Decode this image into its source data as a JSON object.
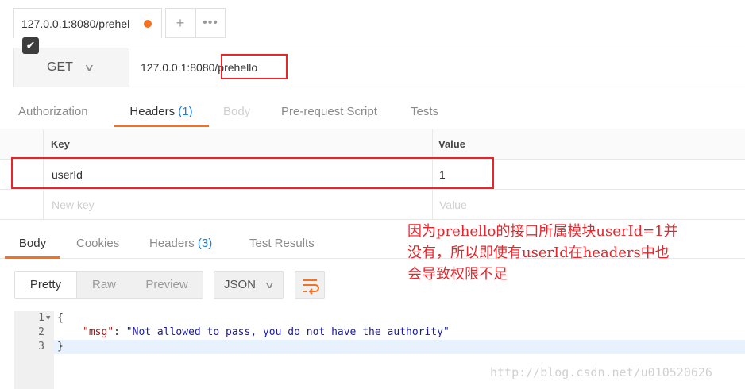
{
  "tabs": {
    "active_title": "127.0.0.1:8080/prehel",
    "add_label": "+",
    "more_label": "•••"
  },
  "request": {
    "method": "GET",
    "url": "127.0.0.1:8080/prehello"
  },
  "request_tabs": [
    {
      "label": "Authorization"
    },
    {
      "label": "Headers",
      "count": "(1)"
    },
    {
      "label": "Body"
    },
    {
      "label": "Pre-request Script"
    },
    {
      "label": "Tests"
    }
  ],
  "headers_table": {
    "col_key": "Key",
    "col_value": "Value",
    "rows": [
      {
        "key": "userId",
        "value": "1",
        "checked": true
      }
    ],
    "new_key_placeholder": "New key",
    "new_value_placeholder": "Value"
  },
  "annotation": {
    "line1": "因为prehello的接口所属模块userId=1并",
    "line2": "没有，所以即使有userId在headers中也",
    "line3": "会导致权限不足"
  },
  "response_tabs": [
    {
      "label": "Body"
    },
    {
      "label": "Cookies"
    },
    {
      "label": "Headers",
      "count": "(3)"
    },
    {
      "label": "Test Results"
    }
  ],
  "response_toolbar": {
    "modes": [
      "Pretty",
      "Raw",
      "Preview"
    ],
    "format": "JSON"
  },
  "response_body": {
    "line_numbers": [
      "1",
      "2",
      "3"
    ],
    "open_brace": "{",
    "key": "\"msg\"",
    "colon": ": ",
    "value": "\"Not allowed to pass, you do not have the authority\"",
    "close_brace": "}"
  },
  "watermark": "http://blog.csdn.net/u010520626",
  "colors": {
    "accent": "#f47023",
    "highlight_box": "#e8252b",
    "count_blue": "#1f7ed1"
  }
}
